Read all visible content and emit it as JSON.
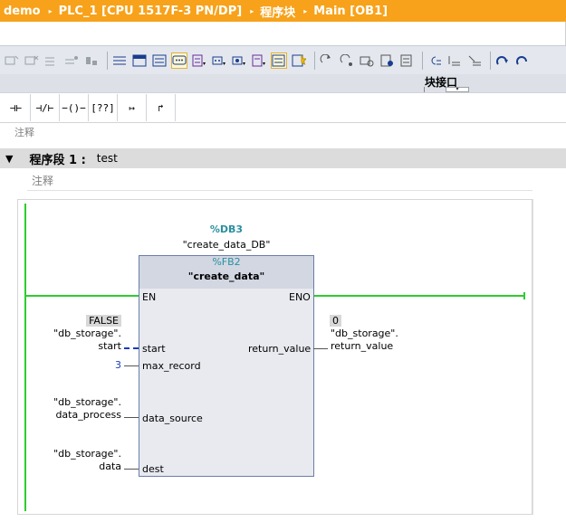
{
  "breadcrumb": [
    "demo",
    "PLC_1 [CPU 1517F-3 PN/DP]",
    "程序块",
    "Main [OB1]"
  ],
  "breadcrumb_separator": "▸",
  "colors": {
    "breadcrumb_bg": "#f7a21a",
    "rail": "#2ecc2e",
    "param_blue": "#1a3bbb",
    "instance_teal": "#2b8fa0"
  },
  "interface_bar": {
    "label": "块接口",
    "collapse_glyph": "▾"
  },
  "lad_toolbar": {
    "no_contact": "⊣⊢",
    "nc_contact": "⊣/⊢",
    "coil": "−()−",
    "empty_box": "[??]",
    "open_branch": "↦",
    "close_branch": "↱"
  },
  "comment_top": "注释",
  "network": {
    "collapse_glyph": "▼",
    "title": "程序段 1 :",
    "name": "test",
    "comment": "注释"
  },
  "block": {
    "db_instance": "%DB3",
    "db_name": "\"create_data_DB\"",
    "fb_number": "%FB2",
    "fb_name": "\"create_data\"",
    "pins": {
      "en": "EN",
      "eno": "ENO",
      "start": "start",
      "max_record": "max_record",
      "data_source": "data_source",
      "dest": "dest",
      "return_value": "return_value"
    }
  },
  "params": {
    "start_value": "FALSE",
    "start_db": "\"db_storage\".",
    "start_member": "start",
    "max_record_value": "3",
    "data_source_db": "\"db_storage\".",
    "data_source_member": "data_process",
    "dest_db": "\"db_storage\".",
    "dest_member": "data",
    "return_live": "0",
    "return_db": "\"db_storage\".",
    "return_member": "return_value"
  },
  "toolbar_icons": [
    "insert-network-icon",
    "delete-network-icon",
    "insert-row-icon",
    "add-row-icon",
    "link-icon",
    "absolute-operands-icon",
    "favorites-icon",
    "comments-icon",
    "network-comments-icon",
    "open-all-icon",
    "close-all-icon",
    "symbol-info-icon",
    "show-symbols-icon",
    "show-favorites-icon",
    "monitor-icon",
    "go-to-error-icon",
    "previous-error-icon",
    "next-error-icon",
    "update-calls-icon",
    "compare-icon",
    "watch-icon",
    "monitoring-on-icon"
  ]
}
